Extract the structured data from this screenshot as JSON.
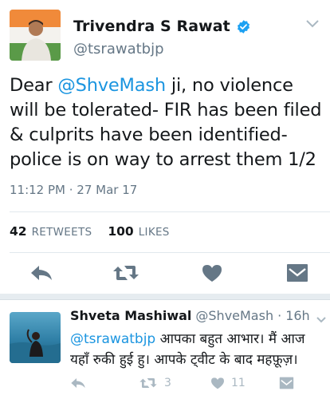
{
  "main_tweet": {
    "author_name": "Trivendra S Rawat",
    "handle": "@tsrawatbjp",
    "text_before": "Dear ",
    "mention": "@ShveMash",
    "text_after": " ji, no violence will be tolerated- FIR has been filed & culprits have been identified-police is on way to arrest them 1/2",
    "timestamp": "11:12 PM · 27 Mar 17",
    "retweets_count": "42",
    "retweets_label": "RETWEETS",
    "likes_count": "100",
    "likes_label": "LIKES",
    "verified_icon": "verified-badge-icon"
  },
  "reply_tweet": {
    "author_name": "Shveta Mashiwal",
    "handle": "@ShveMash",
    "time_sep": "·",
    "time": "16h",
    "mention": "@tsrawatbjp",
    "text": " आपका बहुत आभार। मैं आज यहाँ रुकी हुई हु। आपके ट्वीट के बाद महफ़ूज़।",
    "retweets_count": "3",
    "likes_count": "11"
  },
  "colors": {
    "link": "#1b95e0",
    "icon_main": "#657786",
    "icon_reply": "#aab8c2",
    "verified": "#1da1f2",
    "separator": "#e6ecf0"
  }
}
